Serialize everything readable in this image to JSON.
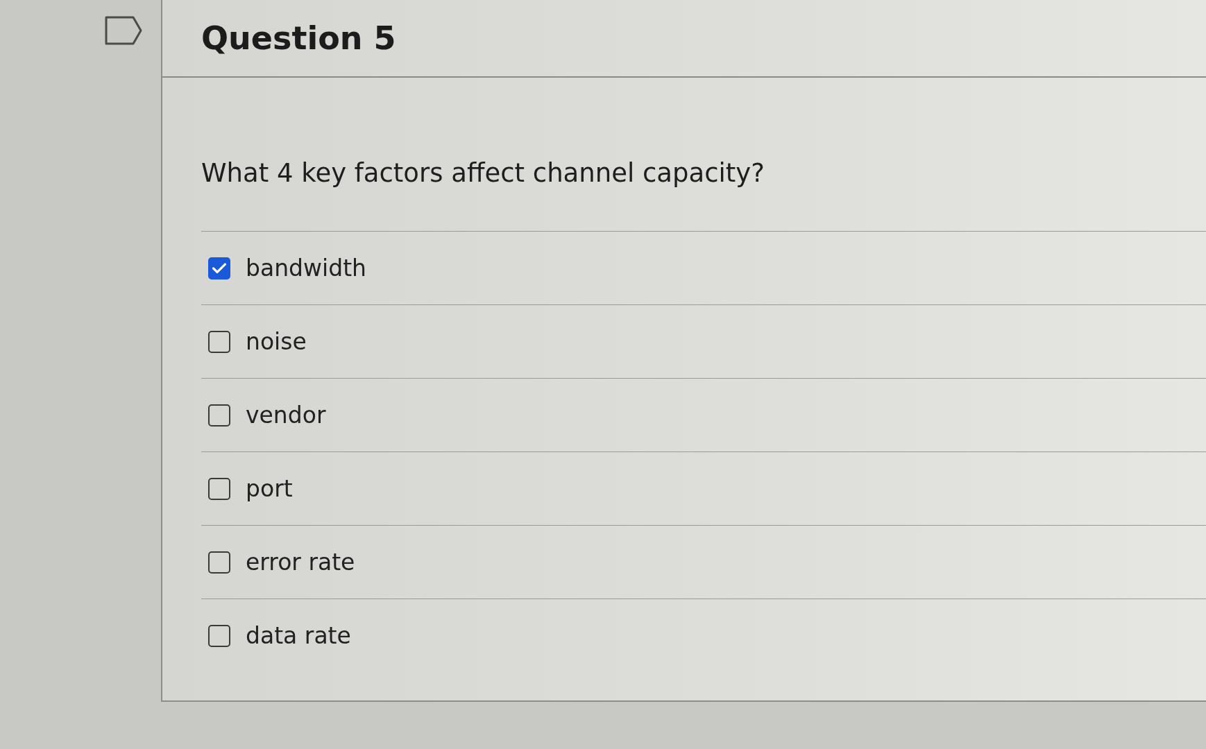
{
  "question": {
    "title": "Question 5",
    "flagged": false,
    "prompt": "What 4 key factors affect channel capacity?"
  },
  "answers": [
    {
      "label": "bandwidth",
      "checked": true
    },
    {
      "label": "noise",
      "checked": false
    },
    {
      "label": "vendor",
      "checked": false
    },
    {
      "label": "port",
      "checked": false
    },
    {
      "label": "error rate",
      "checked": false
    },
    {
      "label": "data rate",
      "checked": false
    }
  ]
}
